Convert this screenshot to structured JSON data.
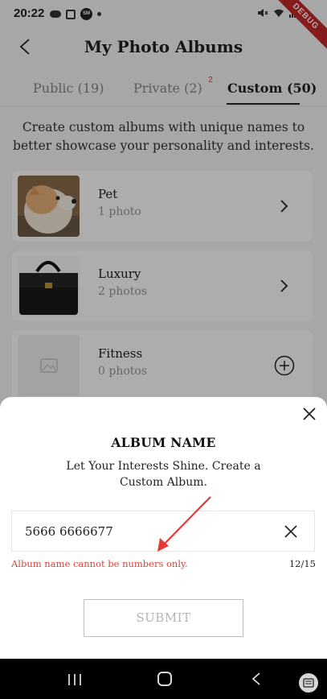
{
  "status_bar": {
    "time": "20:22",
    "avatar_text": "SM",
    "debug_label": "DEBUG"
  },
  "header": {
    "title": "My Photo Albums"
  },
  "tabs": [
    {
      "label": "Public (19)"
    },
    {
      "label": "Private (2)",
      "badge": "2"
    },
    {
      "label": "Custom (50)"
    }
  ],
  "description": "Create custom albums with unique names to better showcase your personality and interests.",
  "albums": [
    {
      "name": "Pet",
      "count": "1 photo"
    },
    {
      "name": "Luxury",
      "count": "2 photos"
    },
    {
      "name": "Fitness",
      "count": "0 photos"
    }
  ],
  "dialog": {
    "title": "ALBUM NAME",
    "subtitle": "Let Your Interests Shine. Create a Custom Album.",
    "input_value": "5666 6666677",
    "error": "Album name cannot be numbers only.",
    "counter": "12/15",
    "submit_label": "SUBMIT"
  },
  "colors": {
    "accent": "#222222",
    "error": "#d6453d",
    "badge": "#d64545"
  },
  "icons": [
    "back-icon",
    "chevron-right-icon",
    "plus-circle-icon",
    "close-icon",
    "image-placeholder-icon"
  ]
}
